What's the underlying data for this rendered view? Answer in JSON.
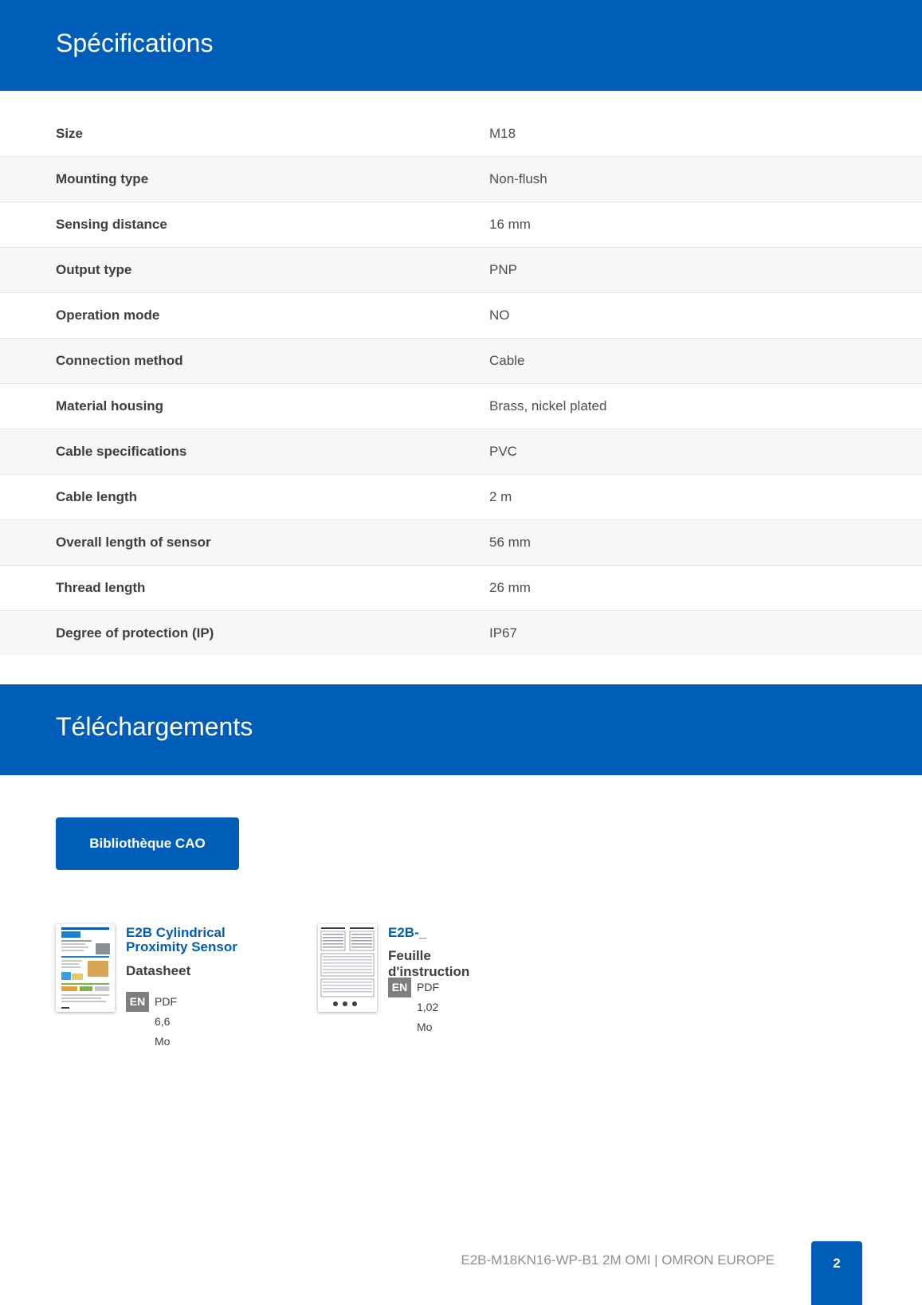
{
  "specifications": {
    "heading": "Spécifications",
    "rows": [
      {
        "label": "Size",
        "value": "M18"
      },
      {
        "label": "Mounting type",
        "value": "Non-flush"
      },
      {
        "label": "Sensing distance",
        "value": "16 mm"
      },
      {
        "label": "Output type",
        "value": "PNP"
      },
      {
        "label": "Operation mode",
        "value": "NO"
      },
      {
        "label": "Connection method",
        "value": "Cable"
      },
      {
        "label": "Material housing",
        "value": "Brass, nickel plated"
      },
      {
        "label": "Cable specifications",
        "value": "PVC"
      },
      {
        "label": "Cable length",
        "value": "2 m"
      },
      {
        "label": "Overall length of sensor",
        "value": "56 mm"
      },
      {
        "label": "Thread length",
        "value": "26 mm"
      },
      {
        "label": "Degree of protection (IP)",
        "value": "IP67"
      }
    ]
  },
  "downloads": {
    "heading": "Téléchargements",
    "cad_button_label": "Bibliothèque CAO",
    "documents": [
      {
        "title": "E2B Cylindrical Proximity Sensor",
        "subtitle": "Datasheet",
        "language": "EN",
        "file_info": "PDF 6,6 Mo"
      },
      {
        "title": "E2B-_",
        "subtitle": "Feuille d'instruction",
        "language": "EN",
        "file_info": "PDF 1,02 Mo"
      }
    ]
  },
  "footer": {
    "text": "E2B-M18KN16-WP-B1 2M OMI | OMRON EUROPE",
    "page_number": "2"
  },
  "colors": {
    "brand_blue": "#005eb8",
    "language_badge_gray": "#7f7f7f",
    "row_alt": "#f7f7f7"
  }
}
